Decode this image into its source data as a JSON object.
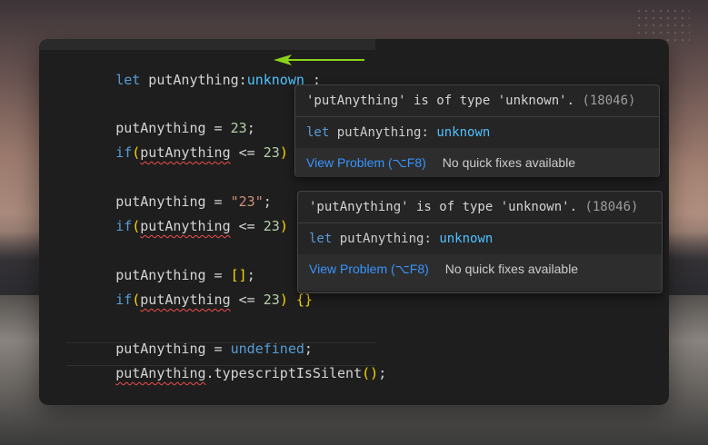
{
  "code": {
    "line1": {
      "kw": "let",
      "name": " putAnything",
      "colon": ":",
      "type": "unknown",
      "end": " ;"
    },
    "assign_num": {
      "name": "putAnything",
      "op": " = ",
      "val": "23",
      "semi": ";"
    },
    "if1": {
      "kw": "if",
      "open": "(",
      "name": "putAnything",
      "op": " <= ",
      "val": "23",
      "close": ")",
      "braces": " {}"
    },
    "assign_str": {
      "name": "putAnything",
      "op": " = ",
      "val": "\"23\"",
      "semi": ";"
    },
    "if2": {
      "kw": "if",
      "open": "(",
      "name": "putAnything",
      "op": " <= ",
      "val": "23",
      "close": ")",
      "braces": " {}"
    },
    "assign_arr": {
      "name": "putAnything",
      "op": " = ",
      "val": "[]",
      "semi": ";"
    },
    "if3": {
      "kw": "if",
      "open": "(",
      "name": "putAnything",
      "op": " <= ",
      "val": "23",
      "close": ")",
      "braces": " {}"
    },
    "assign_undef": {
      "name": "putAnything",
      "op": " = ",
      "val": "undefined",
      "semi": ";"
    },
    "call": {
      "name": "putAnything",
      "dot": ".",
      "method": "typescriptIsSilent",
      "parens": "()",
      "semi": ";"
    }
  },
  "hovers": [
    {
      "message": "'putAnything' is of type 'unknown'.",
      "code": "(18046)",
      "sig_kw": "let",
      "sig_name": " putAnything: ",
      "sig_type": "unknown",
      "view_problem": "View Problem (⌥F8)",
      "no_fixes": "No quick fixes available"
    },
    {
      "message": "'putAnything' is of type 'unknown'.",
      "code": "(18046)",
      "sig_kw": "let",
      "sig_name": " putAnything: ",
      "sig_type": "unknown",
      "view_problem": "View Problem (⌥F8)",
      "no_fixes": "No quick fixes available"
    }
  ],
  "colors": {
    "arrow": "#8bd21b",
    "keyword": "#569cd6",
    "link": "#3794ff",
    "error": "#f14c4c"
  }
}
